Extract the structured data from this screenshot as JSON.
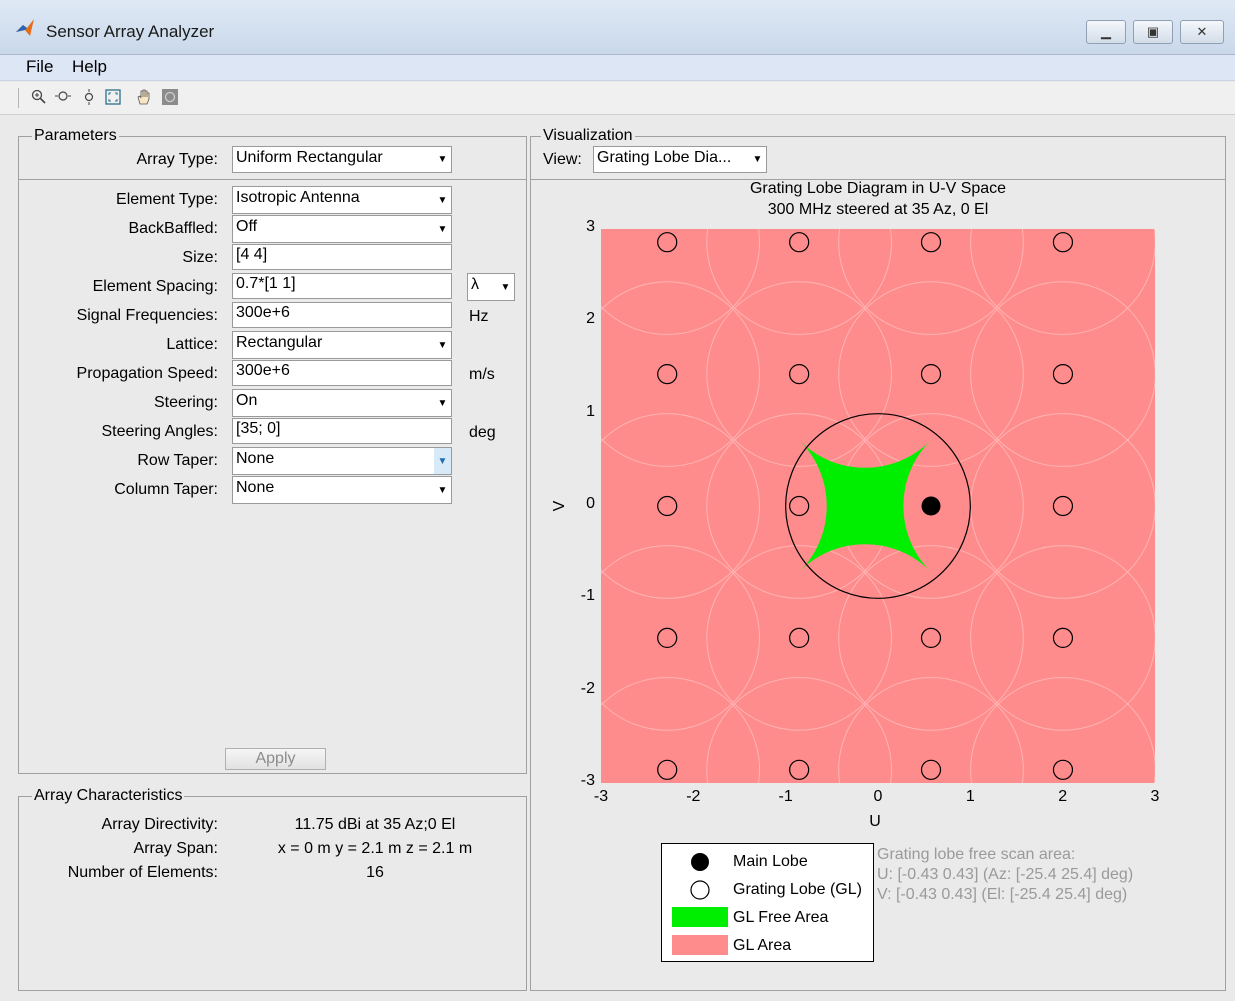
{
  "window": {
    "title": "Sensor Array Analyzer",
    "buttons": [
      "minimize",
      "maximize",
      "close"
    ]
  },
  "menu": [
    "File",
    "Help"
  ],
  "toolbar": [
    "zoom-in-icon",
    "zoom-out-icon",
    "zoom-y-icon",
    "fit-icon",
    "pan-icon",
    "rotate-icon"
  ],
  "parameters": {
    "title": "Parameters",
    "array_type_label": "Array Type:",
    "array_type_value": "Uniform Rectangular",
    "fields": [
      {
        "label": "Element Type:",
        "value": "Isotropic Antenna",
        "kind": "select",
        "unit": ""
      },
      {
        "label": "BackBaffled:",
        "value": "Off",
        "kind": "select",
        "unit": ""
      },
      {
        "label": "Size:",
        "value": "[4 4]",
        "kind": "text",
        "unit": ""
      },
      {
        "label": "Element Spacing:",
        "value": "0.7*[1 1]",
        "kind": "text",
        "unit": "λ"
      },
      {
        "label": "Signal Frequencies:",
        "value": "300e+6",
        "kind": "text",
        "unit": "Hz"
      },
      {
        "label": "Lattice:",
        "value": "Rectangular",
        "kind": "select",
        "unit": ""
      },
      {
        "label": "Propagation Speed:",
        "value": "300e+6",
        "kind": "text",
        "unit": "m/s"
      },
      {
        "label": "Steering:",
        "value": "On",
        "kind": "select",
        "unit": ""
      },
      {
        "label": "Steering Angles:",
        "value": "[35; 0]",
        "kind": "text",
        "unit": "deg"
      },
      {
        "label": "Row Taper:",
        "value": "None",
        "kind": "select",
        "unit": ""
      },
      {
        "label": "Column Taper:",
        "value": "None",
        "kind": "select",
        "unit": ""
      }
    ],
    "apply_label": "Apply"
  },
  "characteristics": {
    "title": "Array Characteristics",
    "rows": [
      {
        "label": "Array Directivity:",
        "value": "11.75 dBi at 35 Az;0 El"
      },
      {
        "label": "Array Span:",
        "value": "x = 0 m  y = 2.1 m  z = 2.1 m"
      },
      {
        "label": "Number of Elements:",
        "value": "16"
      }
    ]
  },
  "visualization": {
    "title": "Visualization",
    "view_label": "View:",
    "view_value": "Grating Lobe Dia..."
  },
  "chart_data": {
    "type": "scatter",
    "title": "Grating Lobe Diagram in U-V Space",
    "subtitle": "300 MHz steered at 35 Az, 0 El",
    "xlabel": "U",
    "ylabel": "V",
    "xlim": [
      -3,
      3
    ],
    "ylim": [
      -3,
      3
    ],
    "xticks": [
      "-3",
      "-2",
      "-1",
      "0",
      "1",
      "2",
      "3"
    ],
    "yticks": [
      "3",
      "2",
      "1",
      "0",
      "-1",
      "-2",
      "-3"
    ],
    "colors": {
      "gl_area": "#ff8c8c",
      "gl_free": "#00ee00",
      "main_lobe": "#000000"
    },
    "main_lobe": {
      "u": 0.574,
      "v": 0
    },
    "grating_lobe_spacing": 1.4286,
    "grating_lobes_u": [
      -2.283,
      -0.854,
      0.574,
      2.003
    ],
    "grating_lobes_v": [
      2.857,
      1.4286,
      0,
      -1.4286,
      -2.857
    ],
    "legend": [
      {
        "label": "Main Lobe",
        "marker": "filled-circle"
      },
      {
        "label": "Grating Lobe (GL)",
        "marker": "open-circle"
      },
      {
        "label": "GL Free Area",
        "marker": "green-box"
      },
      {
        "label": "GL Area",
        "marker": "red-box"
      }
    ],
    "annotation": [
      "Grating lobe free scan area:",
      "U: [-0.43 0.43] (Az: [-25.4 25.4] deg)",
      "V: [-0.43 0.43] (El: [-25.4 25.4] deg)"
    ]
  }
}
